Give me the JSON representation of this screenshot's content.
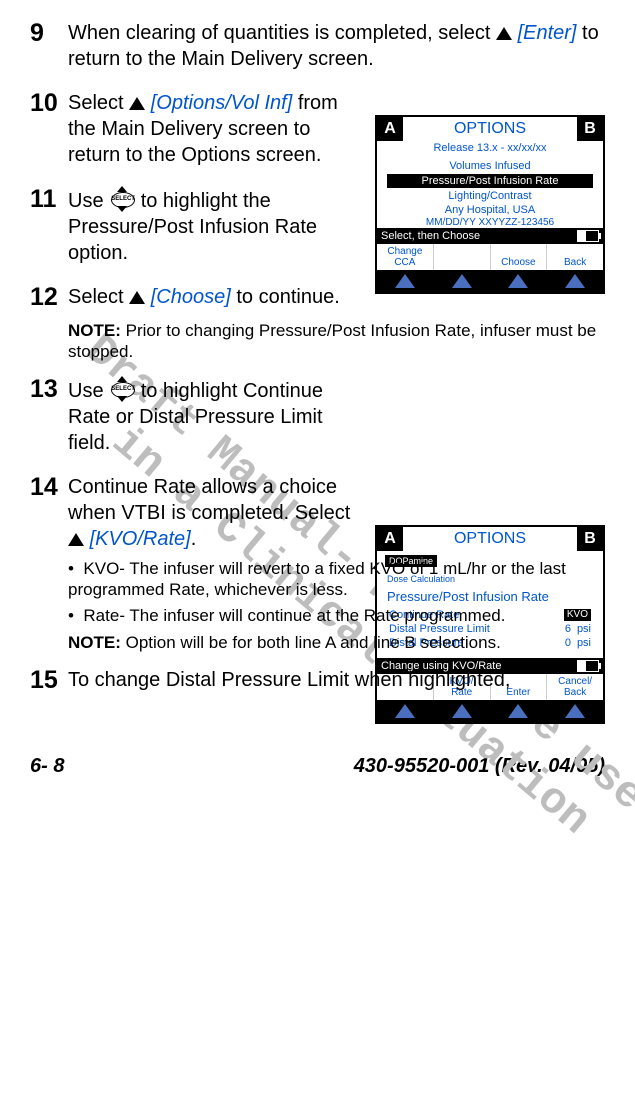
{
  "watermark": "Draft Manual- Not to be used\n   in a Clinical Situation",
  "steps": {
    "s9": {
      "num": "9",
      "text_a": "When clearing of quantities is completed, select ",
      "enter": "[Enter]",
      "text_b": " to return to the Main Delivery screen."
    },
    "s10": {
      "num": "10",
      "text_a": "Select ",
      "opt": "[Options/Vol Inf]",
      "text_b": " from the Main Delivery screen to return to the Options screen."
    },
    "s11": {
      "num": "11",
      "text_a": "Use ",
      "text_b": " to highlight the Pressure/Post Infusion Rate option."
    },
    "s12": {
      "num": "12",
      "text_a": "Select ",
      "choose": "[Choose]",
      "text_b": " to continue."
    },
    "note12": "Prior to changing Pressure/Post Infusion Rate, infuser must be stopped.",
    "s13": {
      "num": "13",
      "text_a": "Use ",
      "text_b": " to highlight Continue Rate or Distal Pressure Limit field."
    },
    "s14": {
      "num": "14",
      "text_a": "Continue Rate allows a choice when VTBI is completed. Select",
      "kvo": "[KVO/Rate]",
      "period": "."
    },
    "bul_a": "KVO- The infuser will revert to a fixed KVO of 1 mL/hr or the last programmed Rate, whichever is less.",
    "bul_b": "Rate- The infuser will continue at the Rate programmed.",
    "note14": "Option will be for both line A and line B selections.",
    "s15": {
      "num": "15",
      "text": "To change Distal Pressure Limit when highlighted,"
    }
  },
  "screen1": {
    "A": "A",
    "B": "B",
    "title": "OPTIONS",
    "release": "Release 13.x - xx/xx/xx",
    "r1": "Volumes Infused",
    "r2": "Pressure/Post Infusion Rate",
    "r3": "Lighting/Contrast",
    "hosp": "Any Hospital, USA",
    "date": "MM/DD/YY XXYYZZ-123456",
    "status": "Select, then Choose",
    "sk1a": "Change",
    "sk1b": "CCA",
    "sk3": "Choose",
    "sk4": "Back"
  },
  "screen2": {
    "A": "A",
    "B": "B",
    "title": "OPTIONS",
    "chip": "DOPamine",
    "subchip": "Dose Calculation",
    "heading": "Pressure/Post Infusion Rate",
    "row1_l": "Continue Rate",
    "row1_v": "KVO",
    "row2_l": "Distal Pressure Limit",
    "row2_v": "6",
    "row2_u": "psi",
    "row3_l": "Distal Pressure",
    "row3_v": "0",
    "row3_u": "psi",
    "status": "Change using KVO/Rate",
    "sk2a": "KVO/",
    "sk2b": "Rate",
    "sk3": "Enter",
    "sk4a": "Cancel/",
    "sk4b": "Back"
  },
  "footer": {
    "left": "6- 8",
    "right": "430-95520-001 (Rev. 04/05)"
  },
  "note_label": "NOTE:"
}
